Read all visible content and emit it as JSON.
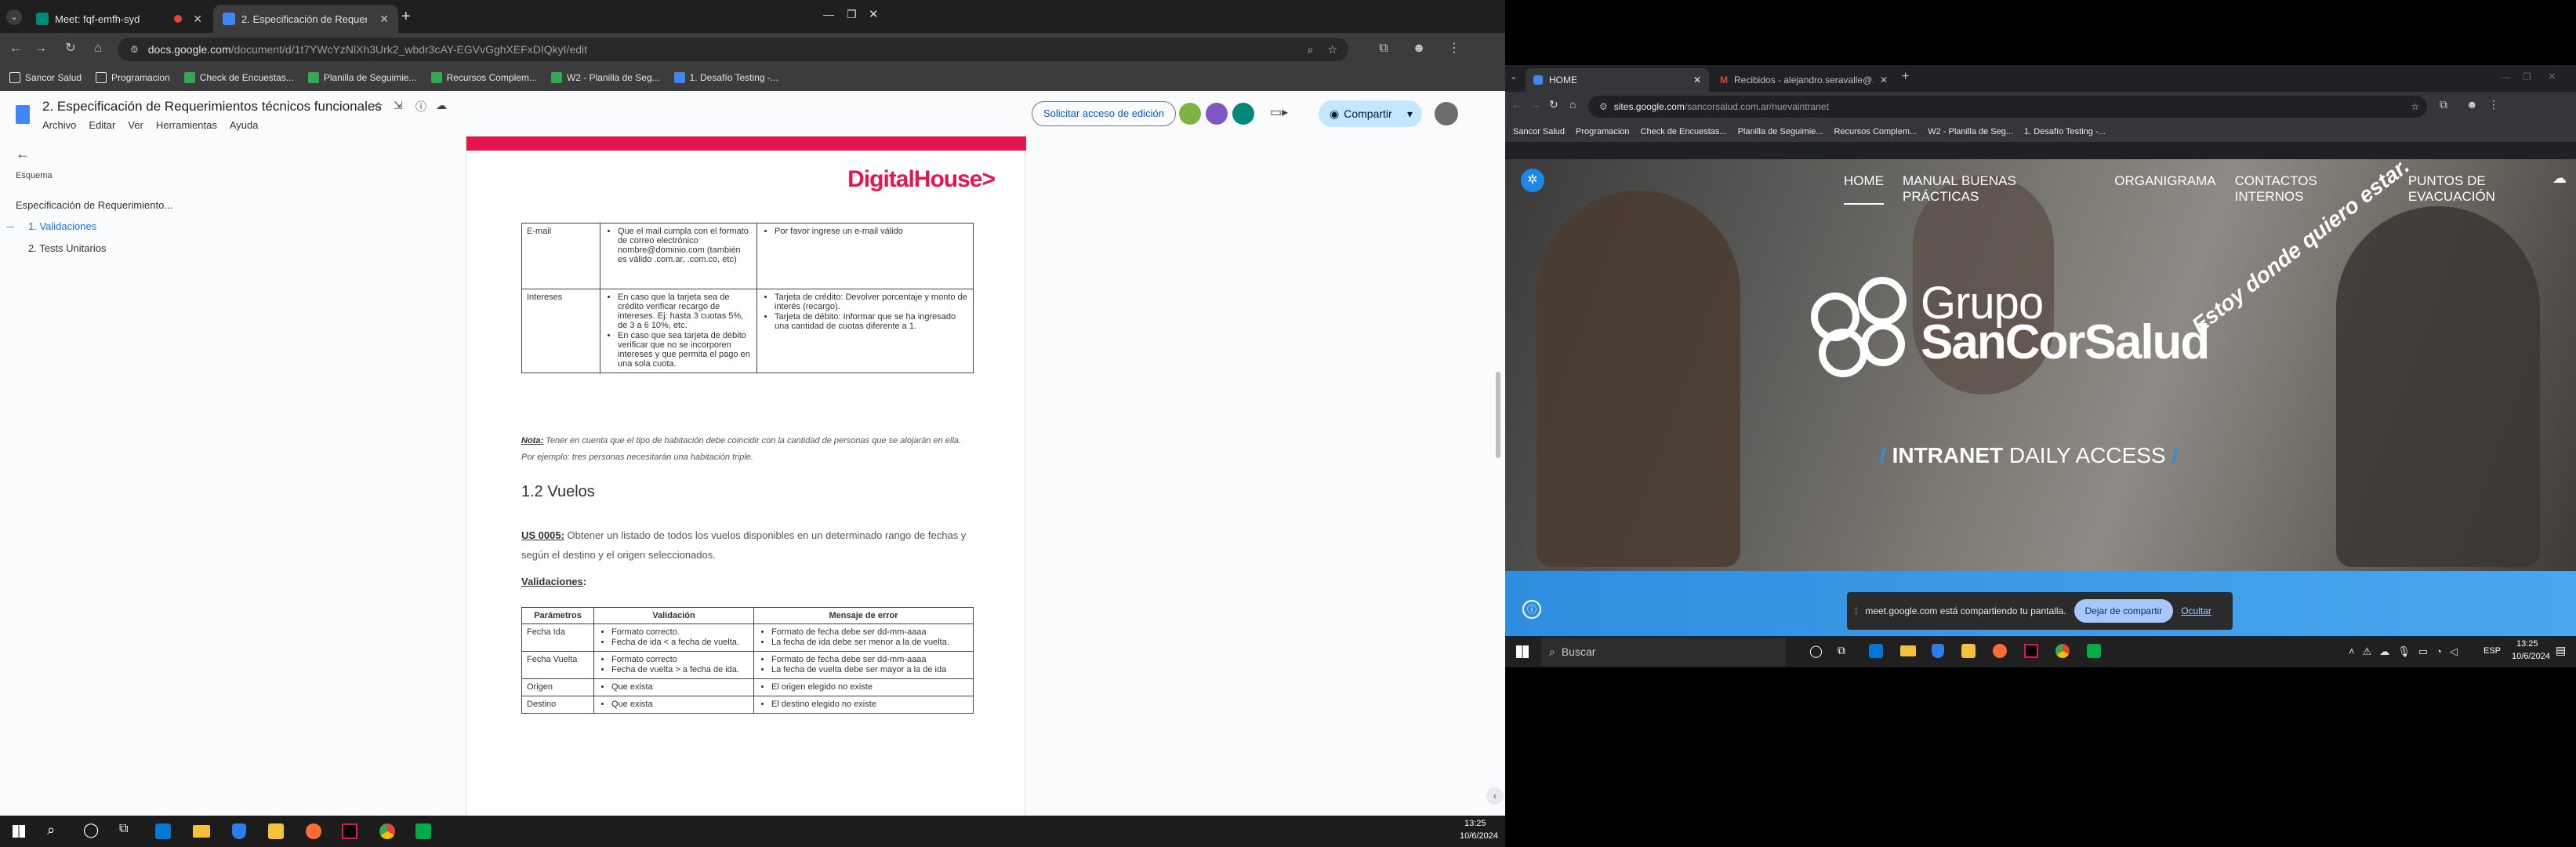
{
  "left_window": {
    "tabs": [
      {
        "label": "Meet: fqf-emfh-syd",
        "favicon_color": "#00897b",
        "recording": true
      },
      {
        "label": "2. Especificación de Requerimi",
        "favicon_color": "#4285f4",
        "active": true
      }
    ],
    "new_tab": "+",
    "url_host": "docs.google.com",
    "url_path": "/document/d/1t7YWcYzNlXh3Urk2_wbdr3cAY-EGVvGghXEFxDIQkyI/edit",
    "bookmarks": [
      {
        "label": "Sancor Salud",
        "icon": "folder-icon",
        "color": "#e8eaed"
      },
      {
        "label": "Programacion",
        "icon": "folder-icon",
        "color": "#e8eaed"
      },
      {
        "label": "Check de Encuestas...",
        "icon": "sheets-icon",
        "color": "#34a853"
      },
      {
        "label": "Planilla de Seguimie...",
        "icon": "sheets-icon",
        "color": "#34a853"
      },
      {
        "label": "Recursos Complem...",
        "icon": "sheets-icon",
        "color": "#34a853"
      },
      {
        "label": "W2 - Planilla de Seg...",
        "icon": "sheets-icon",
        "color": "#34a853"
      },
      {
        "label": "1. Desafío Testing -...",
        "icon": "docs-icon",
        "color": "#4285f4"
      }
    ],
    "doc": {
      "title": "2. Especificación de Requerimientos técnicos funcionales",
      "menu": [
        "Archivo",
        "Editar",
        "Ver",
        "Herramientas",
        "Ayuda"
      ],
      "request_access": "Solicitar acceso de edición",
      "share": "Compartir",
      "outline_label": "Esquema",
      "outline_items": [
        {
          "label": "Especificación de Requerimiento...",
          "level": 0
        },
        {
          "label": "1. Validaciones",
          "level": 1,
          "active": true
        },
        {
          "label": "2. Tests Unitarios",
          "level": 1
        }
      ],
      "logo_text": "DigitalHouse>",
      "table1": [
        {
          "param": "E-mail",
          "validations": [
            "Que el mail cumpla con el formato de correo electrónico nombre@dominio.com (también es válido .com.ar, .com.co, etc)"
          ],
          "errors": [
            "Por favor ingrese un e-mail válido"
          ]
        },
        {
          "param": "Intereses",
          "validations": [
            "En caso que la tarjeta sea de crédito verificar recargo de intereses. Ej: hasta 3 cuotas 5%, de 3 a 6 10%, etc.",
            "En caso que sea tarjeta de débito verificar que no se incorporen intereses y que permita el pago en una sola cuota."
          ],
          "errors": [
            "Tarjeta de crédito: Devolver porcentaje y monto de interés (recargo).",
            "Tarjeta de débito: Informar que se ha ingresado una cantidad de cuotas diferente a 1."
          ]
        }
      ],
      "note_label": "Nota:",
      "note_text": " Tener en cuenta que el tipo de habitación debe coincidir con la cantidad de personas que se alojarán en ella. Por ejemplo: tres personas necesitarán una habitación triple.",
      "section_heading": "1.2 Vuelos",
      "us_label": "US 0005:",
      "us_text": " Obtener un listado de todos los vuelos disponibles en un determinado rango de fechas y según el destino y el origen seleccionados.",
      "validations_label": "Validaciones",
      "table2_headers": [
        "Parámetros",
        "Validación",
        "Mensaje de error"
      ],
      "table2": [
        {
          "param": "Fecha Ida",
          "validations": [
            "Formato correcto.",
            "Fecha de ida < a fecha de vuelta."
          ],
          "errors": [
            "Formato de fecha debe ser dd-mm-aaaa",
            "La fecha de ida debe ser menor a la de vuelta."
          ]
        },
        {
          "param": "Fecha Vuelta",
          "validations": [
            "Formato correcto",
            "Fecha de vuelta > a fecha de ida."
          ],
          "errors": [
            "Formato de fecha debe ser dd-mm-aaaa",
            "La fecha de vuelta debe ser mayor a la de ida"
          ]
        },
        {
          "param": "Origen",
          "validations": [
            "Que exista"
          ],
          "errors": [
            "El origen elegido no existe"
          ]
        },
        {
          "param": "Destino",
          "validations": [
            "Que exista"
          ],
          "errors": [
            "El destino elegido no existe"
          ]
        }
      ]
    },
    "taskbar_time": "13:25",
    "taskbar_date": "10/6/2024"
  },
  "right_window": {
    "tabs": [
      {
        "label": "HOME",
        "active": true
      },
      {
        "label": "Recibidos - alejandro.seravalle@...",
        "active": false
      }
    ],
    "url_host": "sites.google.com",
    "url_path": "/sancorsalud.com.ar/nuevaintranet",
    "bookmarks": [
      "Sancor Salud",
      "Programacion",
      "Check de Encuestas...",
      "Planilla de Seguimie...",
      "Recursos Complem...",
      "W2 - Planilla de Seg...",
      "1. Desafío Testing -..."
    ],
    "site_nav": [
      "HOME",
      "MANUAL BUENAS PRÁCTICAS",
      "ORGANIGRAMA",
      "CONTACTOS INTERNOS",
      "PUNTOS DE EVACUACIÓN"
    ],
    "brand_line1": "Grupo",
    "brand_line2": "SanCorSalud",
    "tagline": "Estoy donde quiero estar.",
    "intranet_bold": "INTRANET",
    "intranet_light": "DAILY ACCESS",
    "share_bar_text": "meet.google.com está compartiendo tu pantalla.",
    "stop_sharing": "Dejar de compartir",
    "hide": "Ocultar",
    "search_placeholder": "Buscar",
    "lang": "ESP",
    "time": "13:25",
    "date": "10/6/2024"
  },
  "colors": {
    "docs_blue": "#1a73e8",
    "digitalhouse_red": "#e3174e",
    "share_pill": "#c2e7ff",
    "intranet_blue": "#2f8de0"
  }
}
